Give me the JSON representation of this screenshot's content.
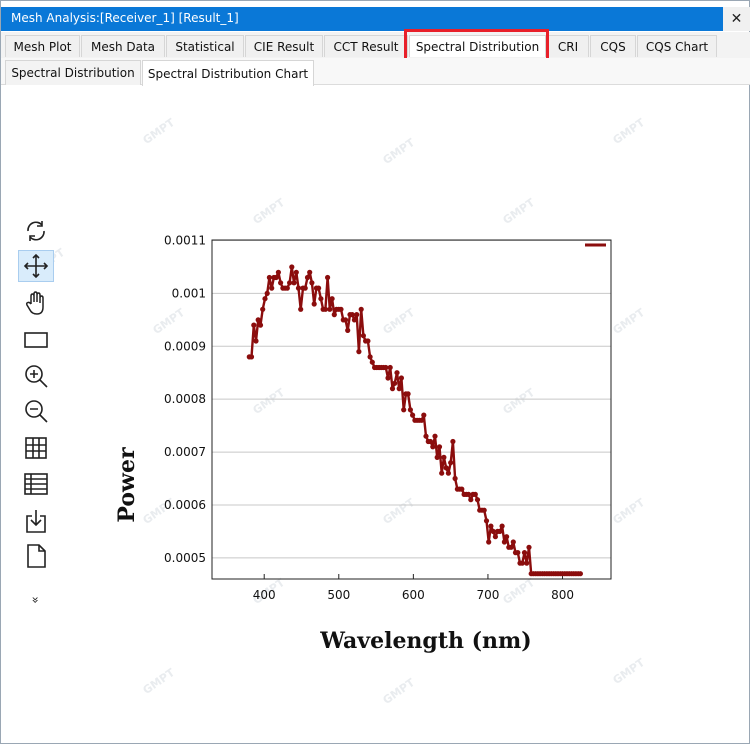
{
  "window": {
    "title": "Mesh Analysis:[Receiver_1] [Result_1]",
    "close_glyph": "✕"
  },
  "tabs_primary": [
    {
      "label": "Mesh Plot"
    },
    {
      "label": "Mesh Data"
    },
    {
      "label": "Statistical"
    },
    {
      "label": "CIE Result"
    },
    {
      "label": "CCT Result"
    },
    {
      "label": "Spectral Distribution",
      "active": true
    },
    {
      "label": "CRI"
    },
    {
      "label": "CQS"
    },
    {
      "label": "CQS Chart"
    }
  ],
  "tabs_secondary": [
    {
      "label": "Spectral Distribution"
    },
    {
      "label": "Spectral Distribution Chart",
      "active": true
    }
  ],
  "toolbar": [
    {
      "icon": "reset-view-icon"
    },
    {
      "icon": "pan-icon",
      "selected": true
    },
    {
      "icon": "hand-icon"
    },
    {
      "icon": "select-rectangle-icon"
    },
    {
      "icon": "zoom-in-icon"
    },
    {
      "icon": "zoom-out-icon"
    },
    {
      "icon": "grid-icon"
    },
    {
      "icon": "table-icon"
    },
    {
      "icon": "export-icon"
    },
    {
      "icon": "document-icon"
    },
    {
      "icon": "more-icon",
      "glyph": "»"
    }
  ],
  "watermark_text": "GMPT",
  "chart_data": {
    "type": "line",
    "title": "",
    "xlabel": "Wavelength (nm)",
    "ylabel": "Power",
    "xlim": [
      330,
      865
    ],
    "ylim": [
      0.00046,
      0.001101
    ],
    "xticks": [
      400,
      500,
      600,
      700,
      800
    ],
    "yticks": [
      0.0005,
      0.0006,
      0.0007,
      0.0008,
      0.0009,
      0.001,
      0.0011
    ],
    "ytick_labels": [
      "0.0005",
      "0.0006",
      "0.0007",
      "0.0008",
      "0.0009",
      "0.001",
      "0.0011"
    ],
    "grid": "horizontal",
    "legend": "top-right",
    "color": "#8b0d0d",
    "series": [
      {
        "x": [
          380,
          383,
          386,
          389,
          392,
          395,
          398,
          401,
          404,
          407,
          410,
          413,
          416,
          419,
          422,
          425,
          428,
          431,
          434,
          437,
          440,
          443,
          446,
          449,
          452,
          455,
          458,
          461,
          464,
          467,
          470,
          473,
          476,
          479,
          482,
          485,
          488,
          491,
          494,
          497,
          500,
          503,
          506,
          509,
          512,
          515,
          518,
          521,
          524,
          527,
          530,
          533,
          536,
          539,
          542,
          545,
          548,
          551,
          554,
          557,
          560,
          563,
          566,
          569,
          572,
          575,
          578,
          581,
          584,
          587,
          590,
          593,
          596,
          599,
          602,
          605,
          608,
          611,
          614,
          617,
          620,
          623,
          626,
          629,
          632,
          635,
          638,
          641,
          644,
          647,
          650,
          653,
          656,
          659,
          662,
          665,
          668,
          671,
          674,
          677,
          680,
          683,
          686,
          689,
          692,
          695,
          698,
          701,
          704,
          707,
          710,
          713,
          716,
          719,
          722,
          725,
          728,
          731,
          734,
          737,
          740,
          743,
          746,
          749,
          752,
          755,
          758,
          761,
          764,
          767,
          770,
          773,
          776,
          779,
          782,
          785,
          788,
          791,
          794,
          797,
          800,
          803,
          806,
          809,
          812,
          815,
          818,
          821,
          824,
          827,
          830
        ],
        "y": [
          0.00088,
          0.00088,
          0.00094,
          0.00091,
          0.00095,
          0.00094,
          0.00097,
          0.00099,
          0.001,
          0.00103,
          0.00101,
          0.00103,
          0.00103,
          0.00104,
          0.00102,
          0.00101,
          0.00101,
          0.00101,
          0.00102,
          0.00105,
          0.00102,
          0.00104,
          0.00101,
          0.00097,
          0.00101,
          0.00101,
          0.00103,
          0.00104,
          0.00102,
          0.00098,
          0.00101,
          0.00101,
          0.00099,
          0.00097,
          0.00097,
          0.00103,
          0.00097,
          0.00099,
          0.00096,
          0.00097,
          0.00097,
          0.00097,
          0.00095,
          0.00095,
          0.00093,
          0.00096,
          0.00096,
          0.00095,
          0.00096,
          0.00089,
          0.00097,
          0.00092,
          0.00091,
          0.00091,
          0.00088,
          0.00087,
          0.00086,
          0.00086,
          0.00086,
          0.00086,
          0.00086,
          0.00086,
          0.00084,
          0.00086,
          0.00082,
          0.00083,
          0.00085,
          0.00082,
          0.00084,
          0.00078,
          0.00081,
          0.00081,
          0.00078,
          0.00077,
          0.00076,
          0.00076,
          0.00076,
          0.00076,
          0.00077,
          0.00073,
          0.00072,
          0.00072,
          0.00071,
          0.00073,
          0.00069,
          0.00071,
          0.00066,
          0.00069,
          0.00067,
          0.00066,
          0.00068,
          0.00072,
          0.00065,
          0.00063,
          0.00063,
          0.00063,
          0.00062,
          0.00062,
          0.00062,
          0.00061,
          0.00062,
          0.00062,
          0.00061,
          0.00059,
          0.00059,
          0.00059,
          0.00057,
          0.00053,
          0.00056,
          0.00055,
          0.00054,
          0.00055,
          0.00055,
          0.00056,
          0.00053,
          0.00054,
          0.00052,
          0.00052,
          0.00053,
          0.00051,
          0.00051,
          0.00049,
          0.00049,
          0.00051,
          0.00049,
          0.00052,
          0.00047,
          0.00047,
          0.00047,
          0.00047,
          0.00047,
          0.00047,
          0.00047,
          0.00047,
          0.00047,
          0.00047,
          0.00047,
          0.00047,
          0.00047,
          0.00047,
          0.00047,
          0.00047,
          0.00047,
          0.00047,
          0.00047,
          0.00047,
          0.00047,
          0.00047,
          0.00047,
          0.00047,
          0.00047
        ]
      }
    ]
  }
}
